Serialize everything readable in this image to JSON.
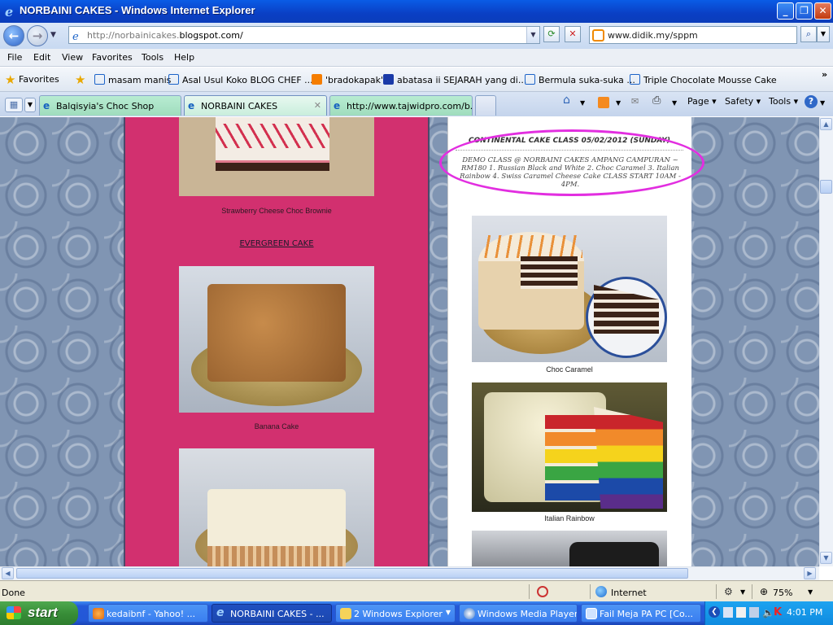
{
  "window": {
    "title": "NORBAINI CAKES - Windows Internet Explorer",
    "url_prefix": "http://norbainicakes.",
    "url_domain": "blogspot.com/",
    "search_value": "www.didik.my/sppm"
  },
  "menu": [
    "File",
    "Edit",
    "View",
    "Favorites",
    "Tools",
    "Help"
  ],
  "favorites": {
    "label": "Favorites",
    "items": [
      "masam manis",
      "Asal Usul Koko  BLOG CHEF ...",
      "'bradokapak'",
      "abatasa ii SEJARAH yang di...",
      "Bermula suka-suka ...",
      "Triple Chocolate Mousse Cake"
    ]
  },
  "tabs": [
    {
      "label": "Balqisyia's Choc Shop"
    },
    {
      "label": "NORBAINI CAKES"
    },
    {
      "label": "http://www.tajwidpro.com/b..."
    }
  ],
  "toolbar": {
    "page": "Page",
    "safety": "Safety",
    "tools": "Tools"
  },
  "page": {
    "left_caption_1": "Strawberry Cheese Choc Brownie",
    "left_link": "EVERGREEN CAKE ",
    "left_caption_2": "Banana Cake",
    "class_title": "CONTINENTAL CAKE CLASS 05/02/2012 (SUNDAY)",
    "class_body": "DEMO CLASS @ NORBAINI CAKES AMPANG CAMPURAN ~ RM180 1. Russian Black and White 2. Choc Caramel 3. Italian Rainbow 4. Swiss Caramel Cheese Cake CLASS START 10AM - 4PM.",
    "right_caption_1": "Choc Caramel",
    "right_caption_2": "Italian Rainbow"
  },
  "status": {
    "text": "Done",
    "zone": "Internet",
    "zoom": "75%"
  },
  "taskbar": {
    "start": "start",
    "tasks": [
      "kedaibnf - Yahoo! ...",
      "NORBAINI CAKES - ...",
      "2 Windows Explorer",
      "Windows Media Player",
      "Fail Meja PA PC [Co..."
    ],
    "clock": "4:01 PM"
  }
}
